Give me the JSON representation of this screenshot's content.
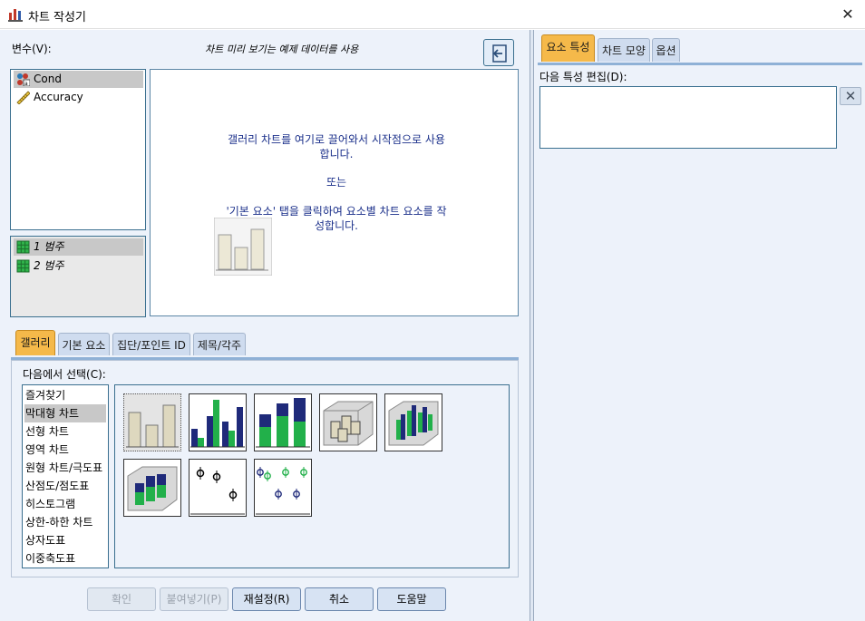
{
  "window": {
    "title": "차트 작성기"
  },
  "variables": {
    "label": "변수(V):",
    "hint": "차트 미리 보기는 예제 데이터를 사용",
    "items": [
      {
        "name": "Cond",
        "icon": "nominal-variable-icon"
      },
      {
        "name": "Accuracy",
        "icon": "scale-ruler-icon"
      }
    ],
    "categories": [
      {
        "name": "1 범주",
        "icon": "category-grid-icon"
      },
      {
        "name": "2 범주",
        "icon": "category-grid-icon"
      }
    ]
  },
  "preview": {
    "line1": "갤러리 차트를 여기로 끌어와서 시작점으로 사용",
    "line2": "합니다.",
    "or": "또는",
    "line3": "'기본 요소' 탭을 클릭하여 요소별 차트 요소를 작",
    "line4": "성합니다."
  },
  "bottom_tabs": [
    "갤러리",
    "기본 요소",
    "집단/포인트 ID",
    "제목/각주"
  ],
  "gallery": {
    "choose_label": "다음에서 선택(C):",
    "types": [
      "즐겨찾기",
      "막대형 차트",
      "선형 차트",
      "영역 차트",
      "원형 차트/극도표",
      "산점도/점도표",
      "히스토그램",
      "상한-하한 차트",
      "상자도표",
      "이중축도표"
    ],
    "selected_type": "막대형 차트"
  },
  "buttons": {
    "ok": "확인",
    "paste": "붙여넣기(P)",
    "reset": "재설정(R)",
    "cancel": "취소",
    "help": "도움말"
  },
  "right_tabs": [
    "요소 특성",
    "차트 모양",
    "옵션"
  ],
  "properties": {
    "edit_label": "다음 특성 편집(D):"
  },
  "colors": {
    "accent_tab": "#f5b94a",
    "panel_bg": "#edf2fa",
    "chart_blue": "#1f2a7a",
    "chart_green": "#22b04a",
    "chart_beige": "#ded8bf"
  }
}
